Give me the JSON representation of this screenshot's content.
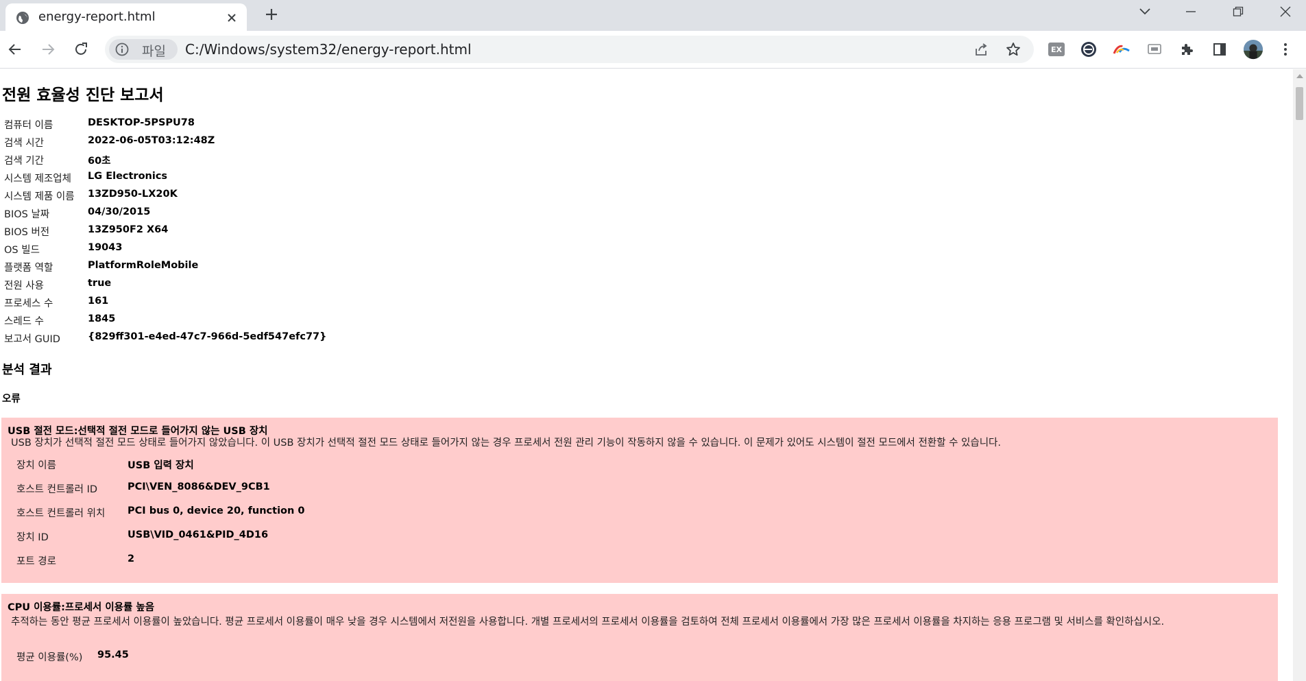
{
  "browser": {
    "tab_title": "energy-report.html",
    "chip_label": "파일",
    "url": "C:/Windows/system32/energy-report.html",
    "extension_ex_label": "EX"
  },
  "report": {
    "title": "전원 효율성 진단 보고서",
    "info": [
      {
        "label": "컴퓨터 이름",
        "value": "DESKTOP-5PSPU78"
      },
      {
        "label": "검색 시간",
        "value": "2022-06-05T03:12:48Z"
      },
      {
        "label": "검색 기간",
        "value": "60초"
      },
      {
        "label": "시스템 제조업체",
        "value": "LG Electronics"
      },
      {
        "label": "시스템 제품 이름",
        "value": "13ZD950-LX20K"
      },
      {
        "label": "BIOS 날짜",
        "value": "04/30/2015"
      },
      {
        "label": "BIOS 버전",
        "value": "13Z950F2 X64"
      },
      {
        "label": "OS 빌드",
        "value": "19043"
      },
      {
        "label": "플랫폼 역할",
        "value": "PlatformRoleMobile"
      },
      {
        "label": "전원 사용",
        "value": "true"
      },
      {
        "label": "프로세스 수",
        "value": "161"
      },
      {
        "label": "스레드 수",
        "value": "1845"
      },
      {
        "label": "보고서 GUID",
        "value": "{829ff301-e4ed-47c7-966d-5edf547efc77}"
      }
    ],
    "analysis_title": "분석 결과",
    "errors_title": "오류",
    "errors": [
      {
        "title": "USB 절전 모드:선택적 절전 모드로 들어가지 않는 USB 장치",
        "description": "USB 장치가 선택적 절전 모드 상태로 들어가지 않았습니다. 이 USB 장치가 선택적 절전 모드 상태로 들어가지 않는 경우 프로세서 전원 관리 기능이 작동하지 않을 수 있습니다. 이 문제가 있어도 시스템이 절전 모드에서 전환할 수 있습니다.",
        "rows": [
          {
            "label": "장치 이름",
            "value": "USB 입력 장치"
          },
          {
            "label": "호스트 컨트롤러 ID",
            "value": "PCI\\VEN_8086&DEV_9CB1"
          },
          {
            "label": "호스트 컨트롤러 위치",
            "value": "PCI bus 0, device 20, function 0"
          },
          {
            "label": "장치 ID",
            "value": "USB\\VID_0461&PID_4D16"
          },
          {
            "label": "포트 경로",
            "value": "2"
          }
        ]
      },
      {
        "title": "CPU 이용률:프로세서 이용률 높음",
        "description": "추적하는 동안 평균 프로세서 이용률이 높았습니다. 평균 프로세서 이용률이 매우 낮을 경우 시스템에서 저전원을 사용합니다. 개별 프로세서의 프로세서 이용률을 검토하여 전체 프로세서 이용률에서 가장 많은 프로세서 이용률을 차지하는 응용 프로그램 및 서비스를 확인하십시오.",
        "rows": [
          {
            "label": "평균 이용률(%)",
            "value": "95.45"
          }
        ]
      }
    ]
  },
  "colors": {
    "tabstrip": "#dee1e6",
    "error_bg": "#ffcccc"
  }
}
